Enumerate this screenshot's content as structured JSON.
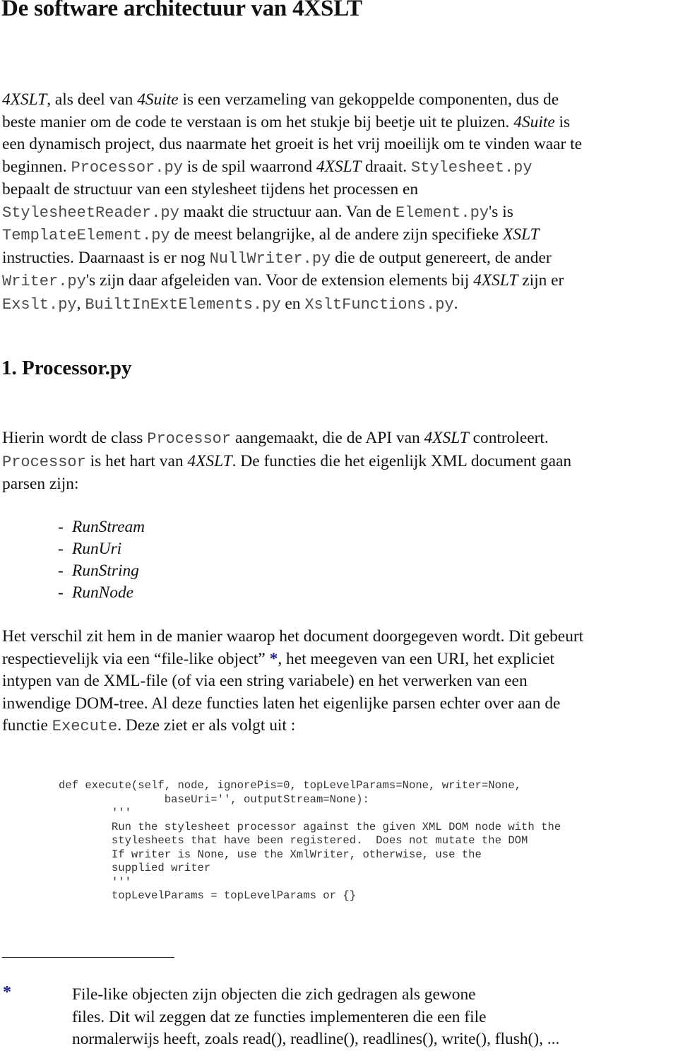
{
  "document": {
    "title": "De software architectuur van 4XSLT",
    "intro": {
      "lines": [
        [
          {
            "t": "4XSLT",
            "s": "it"
          },
          {
            "t": ", als deel van "
          },
          {
            "t": "4Suite",
            "s": "it"
          },
          {
            "t": " is een verzameling van gekoppelde componenten, dus de"
          }
        ],
        [
          {
            "t": "beste manier om de code te verstaan is om het stukje bij beetje uit te pluizen. "
          },
          {
            "t": "4Suite",
            "s": "it"
          },
          {
            "t": " is"
          }
        ],
        [
          {
            "t": "een dynamisch project, dus naarmate het groeit is het vrij moeilijk om te vinden waar te"
          }
        ],
        [
          {
            "t": "beginnen. "
          },
          {
            "t": "Processor.py",
            "s": "mono"
          },
          {
            "t": " is de spil waarrond "
          },
          {
            "t": "4XSLT",
            "s": "it"
          },
          {
            "t": " draait. "
          },
          {
            "t": "Stylesheet.py",
            "s": "mono"
          }
        ],
        [
          {
            "t": "bepaalt de structuur van een stylesheet tijdens het processen en"
          }
        ],
        [
          {
            "t": "StylesheetReader.py",
            "s": "mono"
          },
          {
            "t": " maakt die structuur aan. Van de "
          },
          {
            "t": "Element.py",
            "s": "mono"
          },
          {
            "t": "'s is"
          }
        ],
        [
          {
            "t": "TemplateElement.py",
            "s": "mono"
          },
          {
            "t": " de meest belangrijke, al de andere zijn specifieke "
          },
          {
            "t": "XSLT",
            "s": "it"
          }
        ],
        [
          {
            "t": "instructies. Daarnaast is er nog "
          },
          {
            "t": "NullWriter.py",
            "s": "mono"
          },
          {
            "t": " die de output genereert,  de ander"
          }
        ],
        [
          {
            "t": "Writer.py",
            "s": "mono"
          },
          {
            "t": "'s zijn daar afgeleiden van. Voor de extension elements bij "
          },
          {
            "t": "4XSLT",
            "s": "it"
          },
          {
            "t": " zijn er"
          }
        ],
        [
          {
            "t": "Exslt.py",
            "s": "mono"
          },
          {
            "t": ", "
          },
          {
            "t": "BuiltInExtElements.py",
            "s": "mono"
          },
          {
            "t": " en "
          },
          {
            "t": "XsltFunctions.py",
            "s": "mono"
          },
          {
            "t": "."
          }
        ]
      ]
    },
    "section_heading": "1. Processor.py",
    "processor_paragraph": {
      "lines": [
        [
          {
            "t": "Hierin wordt de class "
          },
          {
            "t": "Processor",
            "s": "mono"
          },
          {
            "t": " aangemaakt, die de API van "
          },
          {
            "t": "4XSLT",
            "s": "it"
          },
          {
            "t": " controleert."
          }
        ],
        [
          {
            "t": "Processor",
            "s": "mono"
          },
          {
            "t": " is het hart van "
          },
          {
            "t": "4XSLT",
            "s": "it"
          },
          {
            "t": ". De  functies die het eigenlijk XML document gaan"
          }
        ],
        [
          {
            "t": "parsen zijn:"
          }
        ]
      ]
    },
    "run_functions": {
      "dash": "-",
      "items": [
        "RunStream",
        "RunUri",
        "RunString",
        "RunNode"
      ]
    },
    "difference_paragraph": {
      "lines": [
        [
          {
            "t": "Het verschil zit hem in de manier waarop het document doorgegeven wordt. Dit gebeurt"
          }
        ],
        [
          {
            "t": "respectievelijk via een “file-like object” "
          },
          {
            "t": "*",
            "s": "star"
          },
          {
            "t": ", het meegeven van een URI, het expliciet"
          }
        ],
        [
          {
            "t": "intypen van de XML-file (of via een string variabele) en het verwerken van een"
          }
        ],
        [
          {
            "t": "inwendige DOM-tree. Al deze functies laten het eigenlijke parsen echter over aan de"
          }
        ],
        [
          {
            "t": "functie "
          },
          {
            "t": "Execute",
            "s": "mono"
          },
          {
            "t": ". Deze ziet er als volgt uit :"
          }
        ]
      ]
    },
    "code_listing": [
      "def execute(self, node, ignorePis=0, topLevelParams=None, writer=None,",
      "                baseUri='', outputStream=None):",
      "        '''",
      "        Run the stylesheet processor against the given XML DOM node with the",
      "        stylesheets that have been registered.  Does not mutate the DOM",
      "        If writer is None, use the XmlWriter, otherwise, use the",
      "        supplied writer",
      "        '''",
      "        topLevelParams = topLevelParams or {}"
    ],
    "footnote": {
      "marker": "*",
      "lines": [
        "File-like objecten zijn objecten die zich gedragen als gewone",
        "files. Dit wil zeggen dat ze functies implementeren die een file",
        "normalerwijs heeft, zoals read(), readline(), readlines(), write(), flush(), ..."
      ]
    },
    "colors": {
      "text": "#111111",
      "monospace_text": "#4a4a4a",
      "footnote_marker": "#1a1a8c"
    }
  }
}
